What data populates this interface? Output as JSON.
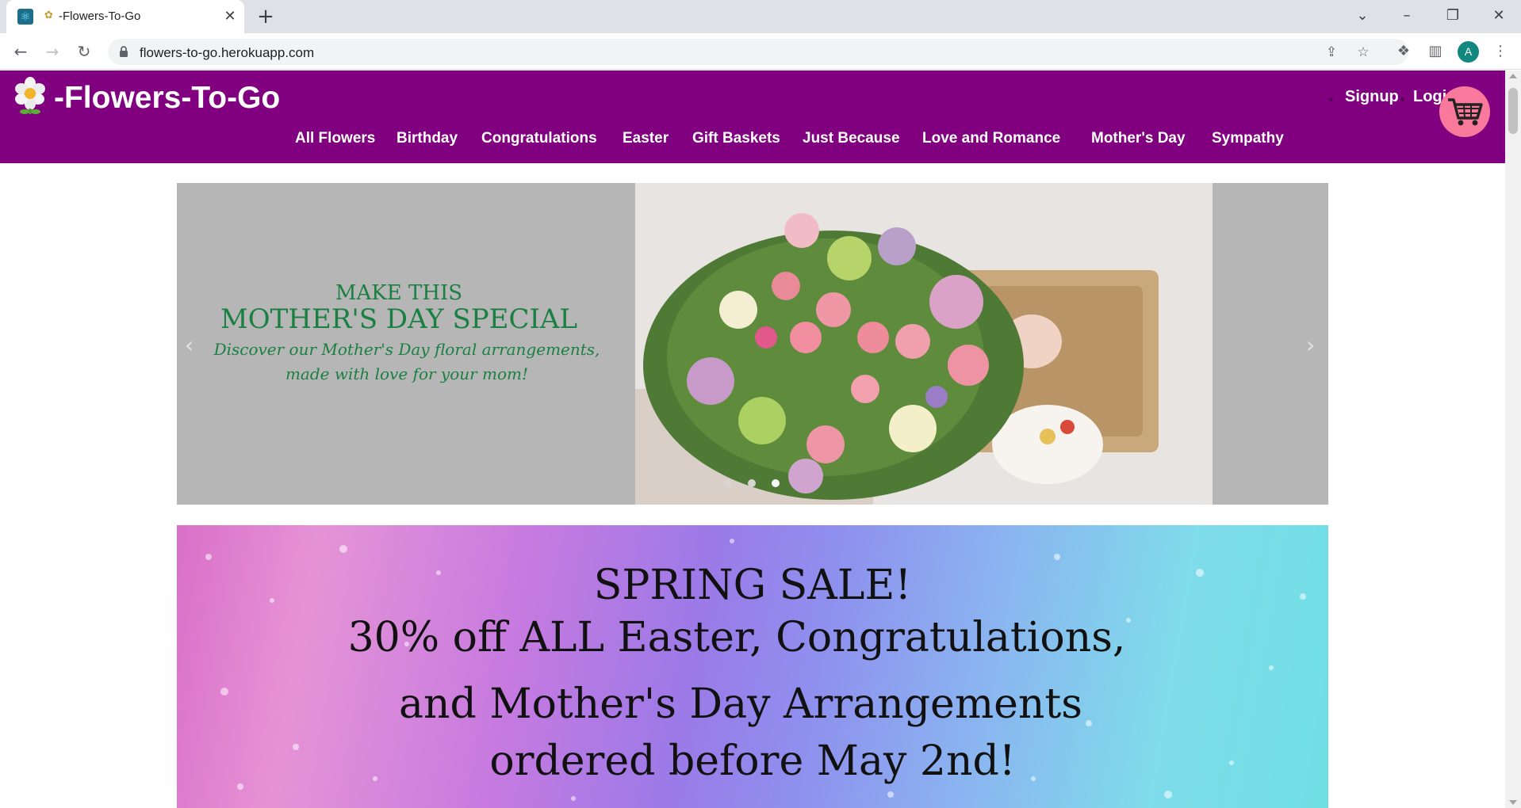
{
  "browser": {
    "tab_title": "-Flowers-To-Go",
    "url": "flowers-to-go.herokuapp.com",
    "profile_initial": "A"
  },
  "site": {
    "title": "-Flowers-To-Go",
    "auth": {
      "signup": "Signup",
      "login": "Logi"
    },
    "nav": [
      "All Flowers",
      "Birthday",
      "Congratulations",
      "Easter",
      "Gift Baskets",
      "Just Because",
      "Love and Romance",
      "Mother's Day",
      "Sympathy"
    ],
    "colors": {
      "header": "#800080",
      "cart": "#f8799b",
      "slide_text": "#1a8042",
      "carousel_bg": "#b6b6b6"
    }
  },
  "carousel": {
    "line1": "MAKE THIS",
    "line2": "MOTHER'S DAY SPECIAL",
    "line3": "Discover our Mother's Day floral arrangements,",
    "line4": "made with love for your mom!",
    "active_index": 2
  },
  "sale": {
    "line1": "SPRING SALE!",
    "line2": "30% off ALL Easter, Congratulations,",
    "line3": "and Mother's Day Arrangements",
    "line4": "ordered before May 2nd!"
  },
  "icons": [
    "react-favicon",
    "flower-icon",
    "close-icon",
    "plus-icon",
    "chevron-down-icon",
    "minimize-icon",
    "restore-icon",
    "window-close-icon",
    "back-icon",
    "forward-icon",
    "reload-icon",
    "lock-icon",
    "share-icon",
    "star-icon",
    "extensions-icon",
    "side-panel-icon",
    "menu-icon",
    "cart-icon"
  ]
}
